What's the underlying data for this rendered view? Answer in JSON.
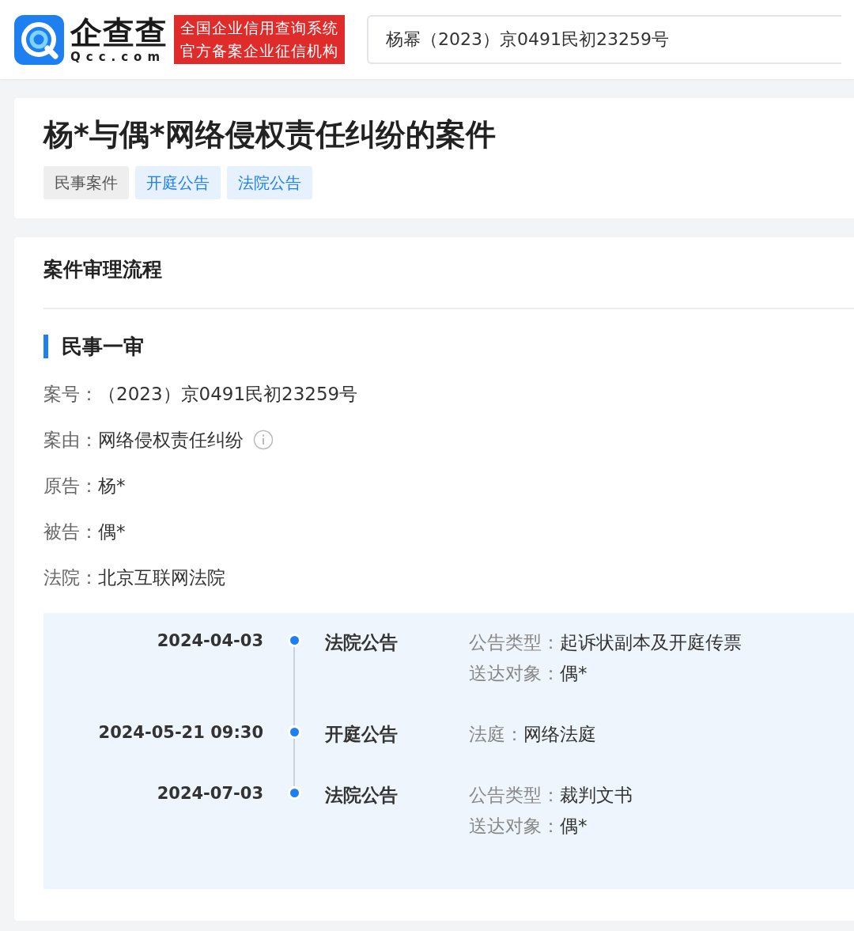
{
  "header": {
    "brand": "企查查",
    "domain": "Qcc.com",
    "badge_lines": [
      "全国企业信用查询系统",
      "官方备案企业征信机构"
    ],
    "search": {
      "value": "杨幂（2023）京0491民初23259号"
    }
  },
  "case": {
    "title": "杨*与偶*网络侵权责任纠纷的案件",
    "tags": [
      {
        "label": "民事案件",
        "kind": "gray"
      },
      {
        "label": "开庭公告",
        "kind": "blue"
      },
      {
        "label": "法院公告",
        "kind": "blue"
      }
    ]
  },
  "process": {
    "heading": "案件审理流程",
    "stage": "民事一审",
    "fields": [
      {
        "label": "案号：",
        "value": "（2023）京0491民初23259号",
        "info": false
      },
      {
        "label": "案由：",
        "value": "网络侵权责任纠纷",
        "info": true
      },
      {
        "label": "原告：",
        "value": "杨*",
        "info": false
      },
      {
        "label": "被告：",
        "value": "偶*",
        "info": false
      },
      {
        "label": "法院：",
        "value": "北京互联网法院",
        "info": false
      }
    ],
    "timeline": [
      {
        "date": "2024-04-03",
        "type": "法院公告",
        "details": [
          {
            "label": "公告类型：",
            "value": "起诉状副本及开庭传票"
          },
          {
            "label": "送达对象：",
            "value": "偶*"
          }
        ]
      },
      {
        "date": "2024-05-21 09:30",
        "type": "开庭公告",
        "details": [
          {
            "label": "法庭：",
            "value": "网络法庭"
          }
        ]
      },
      {
        "date": "2024-07-03",
        "type": "法院公告",
        "details": [
          {
            "label": "公告类型：",
            "value": "裁判文书"
          },
          {
            "label": "送达对象：",
            "value": "偶*"
          }
        ]
      }
    ]
  }
}
